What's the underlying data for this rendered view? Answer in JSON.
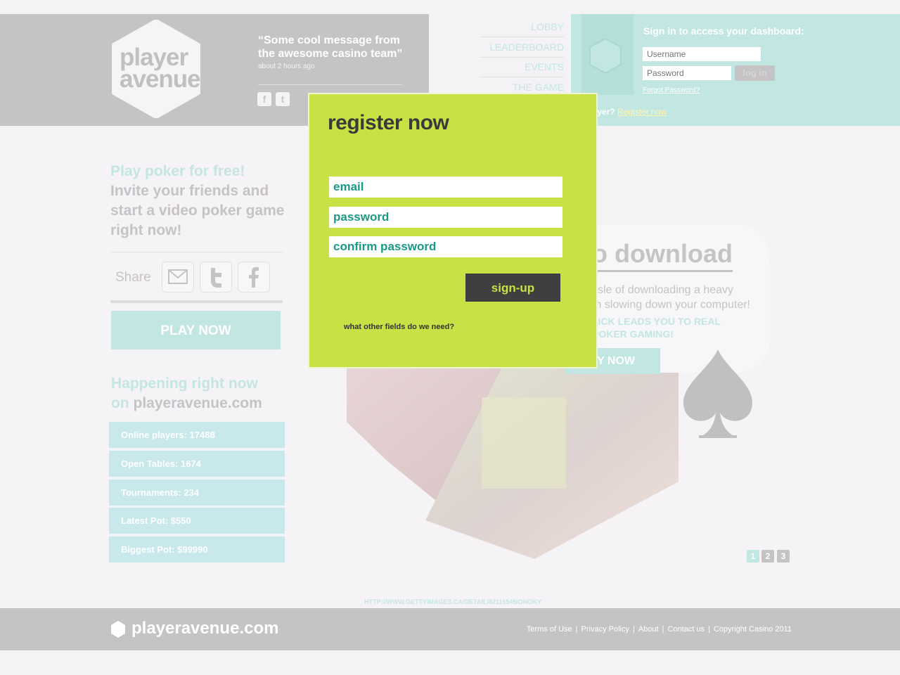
{
  "header": {
    "logo_line1": "player",
    "logo_line2": "avenue",
    "quote": "“Some cool message from the awesome casino team”",
    "quote_time": "about 2 hours ago",
    "social": [
      "f",
      "t"
    ]
  },
  "nav": [
    "LOBBY",
    "LEADERBOARD",
    "EVENTS",
    "THE GAME"
  ],
  "signin": {
    "title": "Sign in to access your dashboard:",
    "username_placeholder": "Username",
    "password_placeholder": "Password",
    "login_label": "log in",
    "forgot": "Forgot Password?",
    "new_player_text": "player?",
    "register_link": "Register now"
  },
  "promo": {
    "line1": "Play poker for free!",
    "line2": "Invite your friends and start a video poker game right now!"
  },
  "share": {
    "label": "Share"
  },
  "play_now": "PLAY NOW",
  "happening": {
    "line1": "Happening right now",
    "on": "on",
    "site": "playeravenue.com"
  },
  "stats": [
    "Online players: 17488",
    "Open Tables: 1674",
    "Tournaments: 234",
    "Latest Pot: $550",
    "Biggest Pot: $99990"
  ],
  "hero": {
    "title": "o download",
    "body1": "ssle of downloading a heavy",
    "body2": "m slowing down your computer!",
    "teal1": "LICK LEADS YOU TO REAL",
    "teal2": "POKER GAMING!",
    "play": "AY NOW",
    "pages": [
      "1",
      "2",
      "3"
    ]
  },
  "credit": "HTTP://WWW.GETTYIMAGES.CA/DETAIL/82115545/ONOKY",
  "footer": {
    "logo": "playeravenue.com",
    "links": [
      "Terms of Use",
      "Privacy Policy",
      "About",
      "Contact us",
      "Copyright Casino 2011"
    ]
  },
  "modal": {
    "title": "register now",
    "email": "email",
    "password": "password",
    "confirm": "confirm password",
    "signup": "sign-up",
    "note": "what other fields do we need?"
  }
}
